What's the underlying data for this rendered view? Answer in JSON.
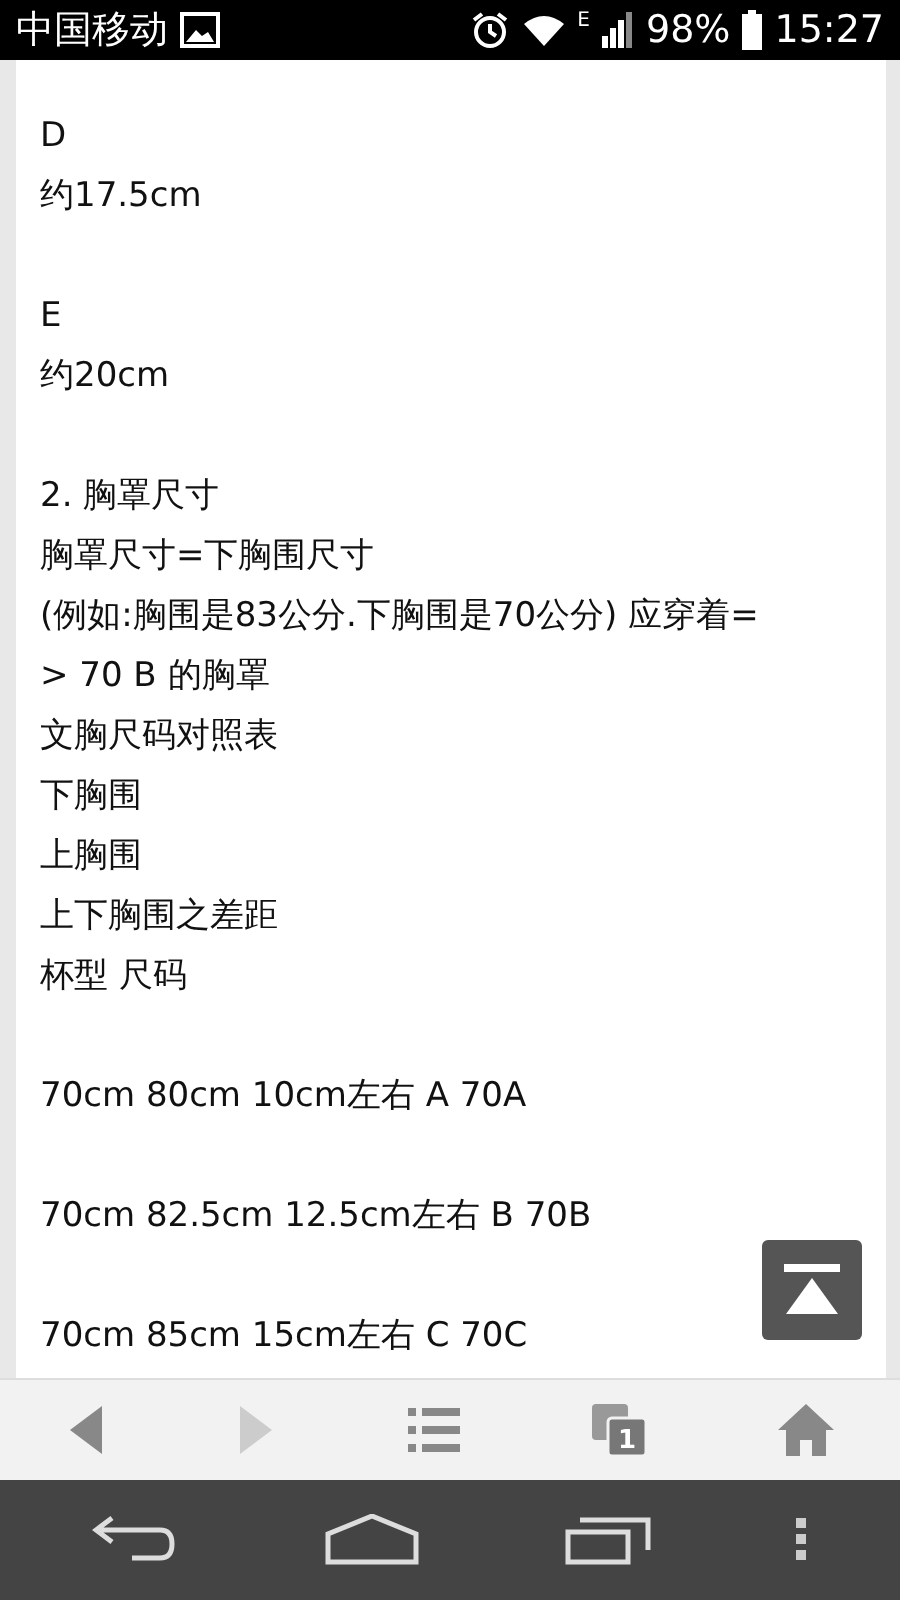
{
  "status_bar": {
    "carrier": "中国移动",
    "battery": "98%",
    "network": "E",
    "time": "15:27"
  },
  "content": {
    "blocks": [
      [
        "D",
        "约17.5cm"
      ],
      [
        "E",
        "约20cm"
      ],
      [
        "2. 胸罩尺寸",
        "胸罩尺寸=下胸围尺寸",
        "(例如:胸围是83公分.下胸围是70公分) 应穿着=",
        "> 70 B 的胸罩",
        "文胸尺码对照表",
        "下胸围",
        "上胸围",
        "上下胸围之差距",
        "杯型 尺码"
      ],
      [
        "70cm 80cm 10cm左右 A 70A"
      ],
      [
        "70cm 82.5cm 12.5cm左右 B 70B"
      ],
      [
        "70cm 85cm 15cm左右 C 70C"
      ]
    ]
  },
  "toolbar": {
    "tab_count": "1",
    "forward_disabled": true
  }
}
